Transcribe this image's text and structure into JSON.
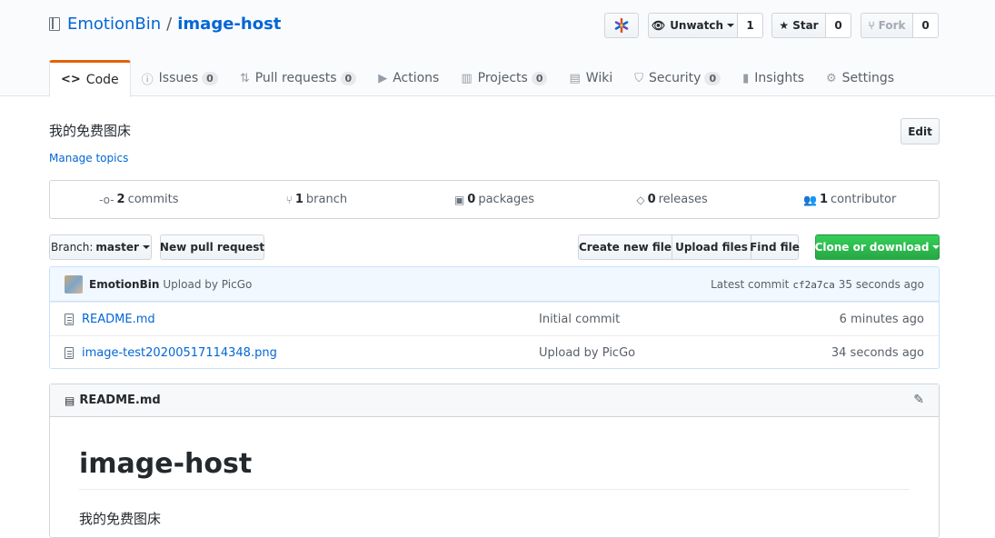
{
  "repo": {
    "owner": "EmotionBin",
    "separator": "/",
    "name": "image-host"
  },
  "actions": {
    "app_icon": "colorful-asterisk-icon",
    "watch": {
      "label": "Unwatch",
      "count": "1"
    },
    "star": {
      "label": "Star",
      "count": "0"
    },
    "fork": {
      "label": "Fork",
      "count": "0"
    }
  },
  "tabs": [
    {
      "label": "Code",
      "icon": "<>"
    },
    {
      "label": "Issues",
      "count": "0"
    },
    {
      "label": "Pull requests",
      "count": "0"
    },
    {
      "label": "Actions"
    },
    {
      "label": "Projects",
      "count": "0"
    },
    {
      "label": "Wiki"
    },
    {
      "label": "Security",
      "count": "0"
    },
    {
      "label": "Insights"
    },
    {
      "label": "Settings"
    }
  ],
  "description": "我的免费图床",
  "manage_topics": "Manage topics",
  "edit_label": "Edit",
  "summary": {
    "commits": {
      "count": "2",
      "label": "commits"
    },
    "branch": {
      "count": "1",
      "label": "branch"
    },
    "packages": {
      "count": "0",
      "label": "packages"
    },
    "releases": {
      "count": "0",
      "label": "releases"
    },
    "contributors": {
      "count": "1",
      "label": "contributor"
    }
  },
  "branch": {
    "prefix": "Branch:",
    "name": "master"
  },
  "new_pr": "New pull request",
  "file_actions": {
    "create": "Create new file",
    "upload": "Upload files",
    "find": "Find file"
  },
  "clone": "Clone or download",
  "latest_commit": {
    "author": "EmotionBin",
    "message": "Upload by PicGo",
    "prefix": "Latest commit",
    "sha": "cf2a7ca",
    "age": "35 seconds ago"
  },
  "files": [
    {
      "name": "README.md",
      "message": "Initial commit",
      "age": "6 minutes ago"
    },
    {
      "name": "image-test20200517114348.png",
      "message": "Upload by PicGo",
      "age": "34 seconds ago"
    }
  ],
  "readme": {
    "title": "README.md",
    "heading": "image-host",
    "body": "我的免费图床"
  },
  "colors": {
    "link": "#0366d6",
    "clone_green": "#28a745",
    "tab_accent": "#e36209"
  }
}
